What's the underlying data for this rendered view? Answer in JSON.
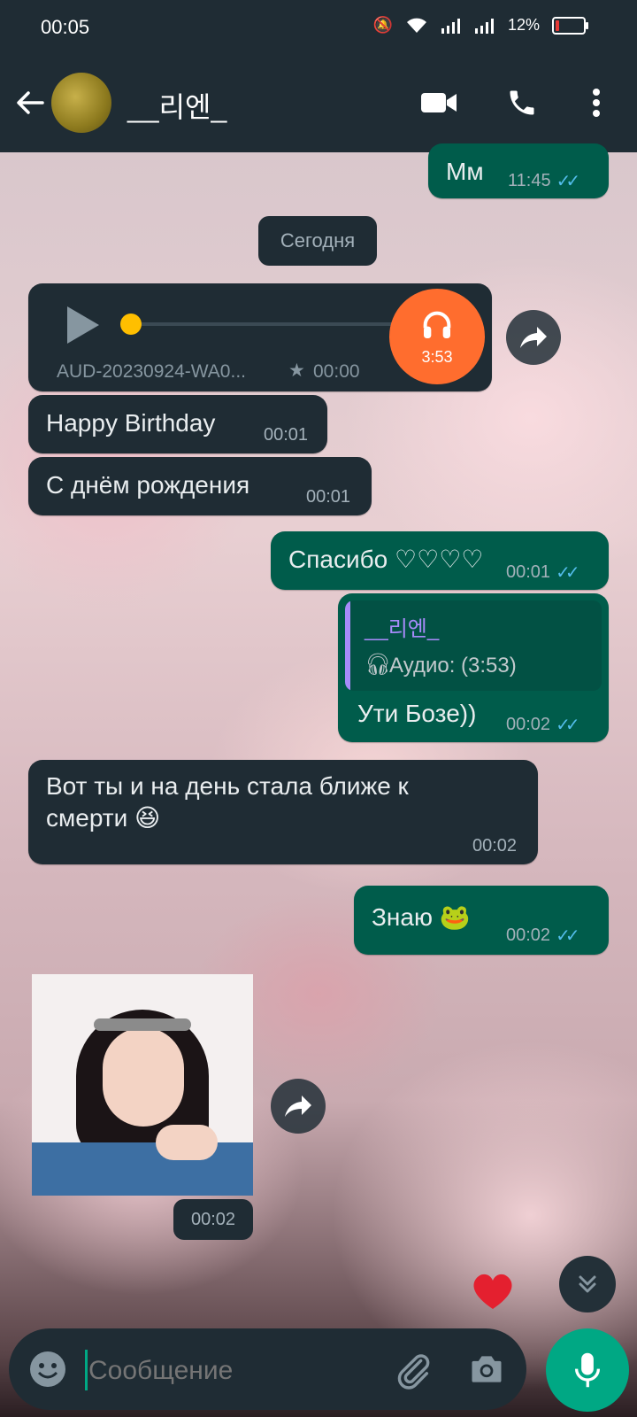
{
  "status_bar": {
    "time": "00:05",
    "battery": "12%"
  },
  "header": {
    "contact_name": "__리엔_"
  },
  "date_separator": "Сегодня",
  "messages": [
    {
      "dir": "out",
      "text": "Мм",
      "time": "11:45",
      "read": true
    },
    {
      "dir": "in",
      "type": "audio",
      "file": "AUD-20230924-WA0...",
      "position": "00:00",
      "duration": "3:53",
      "starred": true,
      "progress": 0
    },
    {
      "dir": "in",
      "text": "Happy Birthday",
      "time": "00:01"
    },
    {
      "dir": "in",
      "text": "С днём рождения",
      "time": "00:01"
    },
    {
      "dir": "out",
      "text": "Спасибо ♡♡♡♡",
      "time": "00:01",
      "read": true
    },
    {
      "dir": "out",
      "quote_author": "__리엔_",
      "quote_text": "Аудио: (3:53)",
      "text": "Ути Бозе))",
      "time": "00:02",
      "read": true
    },
    {
      "dir": "in",
      "text": "Вот ты и на день стала ближе к смерти 😆",
      "time": "00:02"
    },
    {
      "dir": "out",
      "text": "Знаю 🐸",
      "time": "00:02",
      "read": true
    },
    {
      "dir": "in",
      "type": "sticker",
      "time": "00:02"
    }
  ],
  "input": {
    "placeholder": "Сообщение"
  },
  "colors": {
    "incoming": "#1f2c34",
    "outgoing": "#005c4b",
    "accent": "#00a884",
    "audio_badge": "#ff6d2e",
    "read_ticks": "#53bdeb"
  }
}
